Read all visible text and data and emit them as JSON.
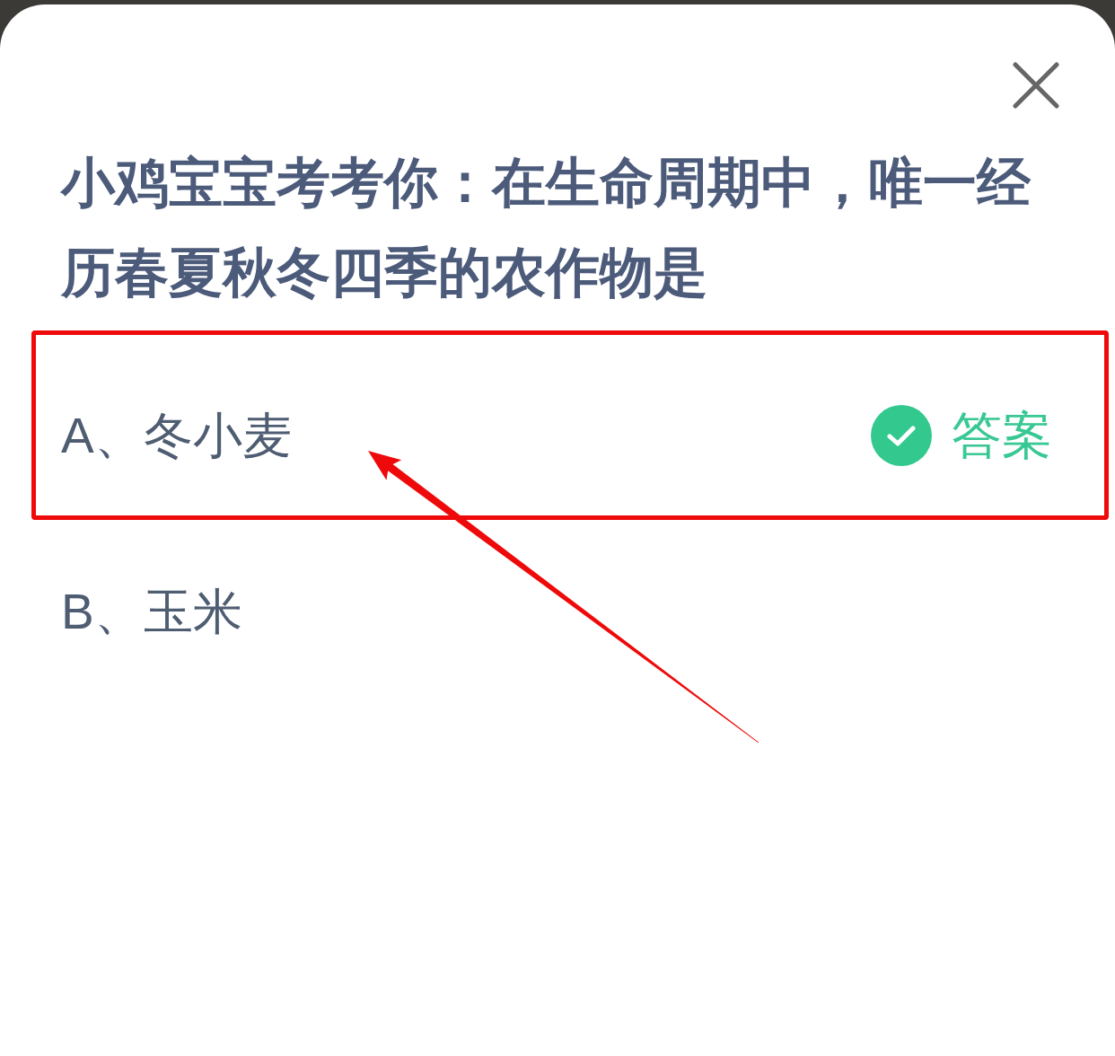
{
  "dialog": {
    "question": "小鸡宝宝考考你：在生命周期中，唯一经历春夏秋冬四季的农作物是",
    "options": [
      {
        "text": "A、冬小麦",
        "correct": true,
        "answer_label": "答案",
        "highlighted": true,
        "arrow": true
      },
      {
        "text": "B、玉米",
        "correct": false,
        "highlighted": false,
        "arrow": false
      }
    ]
  }
}
